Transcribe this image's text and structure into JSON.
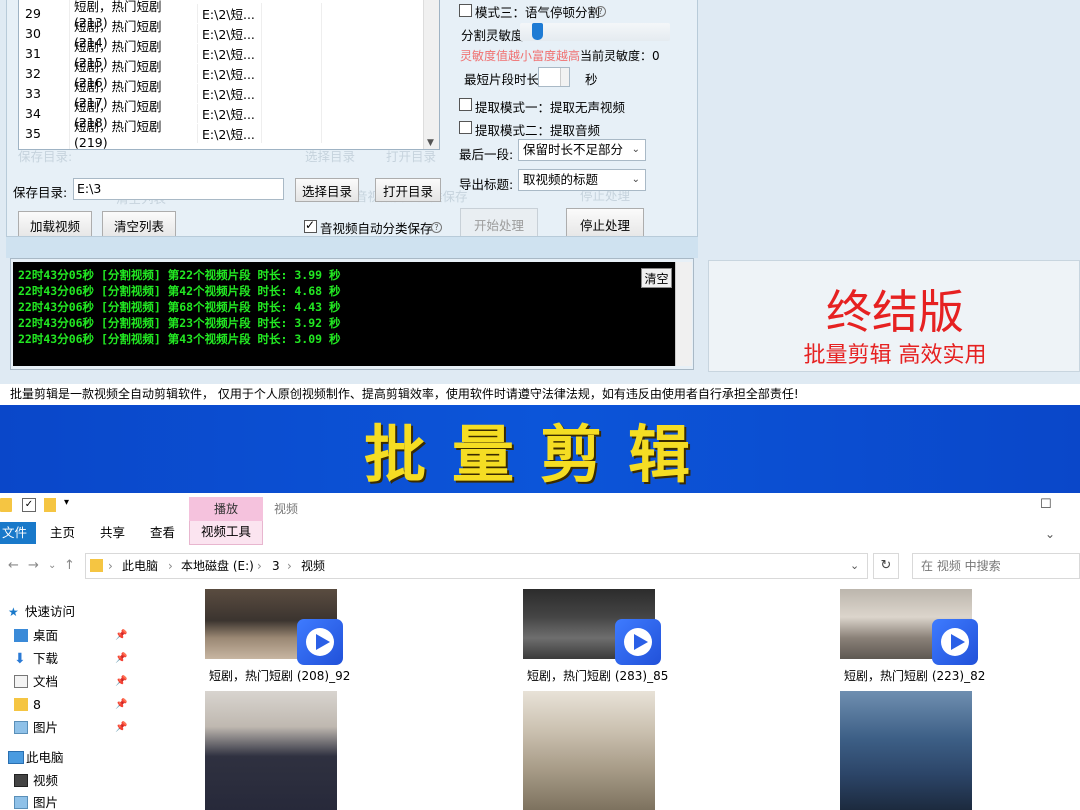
{
  "file_table": {
    "rows": [
      {
        "num": "29",
        "name": "短剧，热门短剧 (213)",
        "path": "E:\\2\\短..."
      },
      {
        "num": "30",
        "name": "短剧，热门短剧 (214)",
        "path": "E:\\2\\短..."
      },
      {
        "num": "31",
        "name": "短剧，热门短剧 (215)",
        "path": "E:\\2\\短..."
      },
      {
        "num": "32",
        "name": "短剧，热门短剧 (216)",
        "path": "E:\\2\\短..."
      },
      {
        "num": "33",
        "name": "短剧，热门短剧 (217)",
        "path": "E:\\2\\短..."
      },
      {
        "num": "34",
        "name": "短剧，热门短剧 (218)",
        "path": "E:\\2\\短..."
      },
      {
        "num": "35",
        "name": "短剧，热门短剧 (219)",
        "path": "E:\\2\\短..."
      }
    ]
  },
  "left_controls": {
    "save_dir_label": "保存目录:",
    "save_dir_value": "E:\\3",
    "select_dir_button": "选择目录",
    "open_dir_button": "打开目录",
    "add_video_button": "加载视频",
    "clear_list_button": "清空列表",
    "auto_classify_label": "音视频自动分类保存",
    "ghost_save_dir": "保存目录:",
    "ghost_select_dir": "选择目录",
    "ghost_open_dir": "打开目录",
    "ghost_clear_list": "清空列表",
    "ghost_load": "加载视",
    "ghost_auto": "音视频自动分类保存"
  },
  "right_controls": {
    "mode3_label": "模式三：语气停顿分割",
    "sensitivity_label": "分割灵敏度",
    "sensitivity_hint": "灵敏度值越小富度越高",
    "current_sensitivity": "当前灵敏度：0",
    "min_len_label": "最短片段时长:",
    "min_len_unit": "秒",
    "extract1_label": "提取模式一：提取无声视频",
    "extract2_label": "提取模式二：提取音频",
    "last_segment_label": "最后一段:",
    "last_segment_value": "保留时长不足部分",
    "export_title_label": "导出标题:",
    "export_title_value": "取视频的标题",
    "start_button": "开始处理",
    "stop_button": "停止处理",
    "ghost_stop": "停止处理"
  },
  "console": {
    "clear_label": "清空",
    "lines": [
      "22时43分05秒 [分割视频] 第22个视频片段 时长: 3.99 秒",
      "22时43分06秒 [分割视频] 第42个视频片段 时长: 4.68 秒",
      "22时43分06秒 [分割视频] 第68个视频片段 时长: 4.43 秒",
      "22时43分06秒 [分割视频] 第23个视频片段 时长: 3.92 秒",
      "22时43分06秒 [分割视频] 第43个视频片段 时长: 3.09 秒"
    ]
  },
  "promo": {
    "title": "终结版",
    "subtitle": "批量剪辑 高效实用"
  },
  "disclaimer": "批量剪辑是一款视频全自动剪辑软件， 仅用于个人原创视频制作、提高剪辑效率，使用软件时请遵守法律法规，如有违反由使用者自行承担全部责任!",
  "banner": "批量剪辑",
  "explorer": {
    "context_group": "播放",
    "context_title": "视频",
    "tabs": [
      "文件",
      "主页",
      "共享",
      "查看",
      "视频工具"
    ],
    "breadcrumb": [
      "此电脑",
      "本地磁盘 (E:)",
      "3",
      "视频"
    ],
    "search_placeholder": "在 视频 中搜索",
    "nav": [
      {
        "label": "快速访问",
        "icon": "star-icon"
      },
      {
        "label": "桌面",
        "icon": "desktop-icon"
      },
      {
        "label": "下载",
        "icon": "download-icon"
      },
      {
        "label": "文档",
        "icon": "document-icon"
      },
      {
        "label": "8",
        "icon": "folder-icon"
      },
      {
        "label": "图片",
        "icon": "pictures-icon"
      },
      {
        "label": "此电脑",
        "icon": "computer-icon"
      },
      {
        "label": "视频",
        "icon": "video-folder-icon"
      },
      {
        "label": "图片",
        "icon": "pictures-icon"
      }
    ],
    "files": [
      {
        "caption": "短剧，热门短剧 (208)_92"
      },
      {
        "caption": "短剧，热门短剧 (283)_85"
      },
      {
        "caption": "短剧，热门短剧 (223)_82"
      }
    ],
    "ghost_breadcrumb": [
      "此电脑",
      "本地磁盘 (E:)",
      "3",
      "视频"
    ]
  },
  "colors": {
    "banner_bg": "#0c55d9",
    "banner_text": "#f5dd23",
    "promo_red": "#e62121",
    "console_green": "#22e822",
    "file_tab_blue": "#1979ca"
  }
}
